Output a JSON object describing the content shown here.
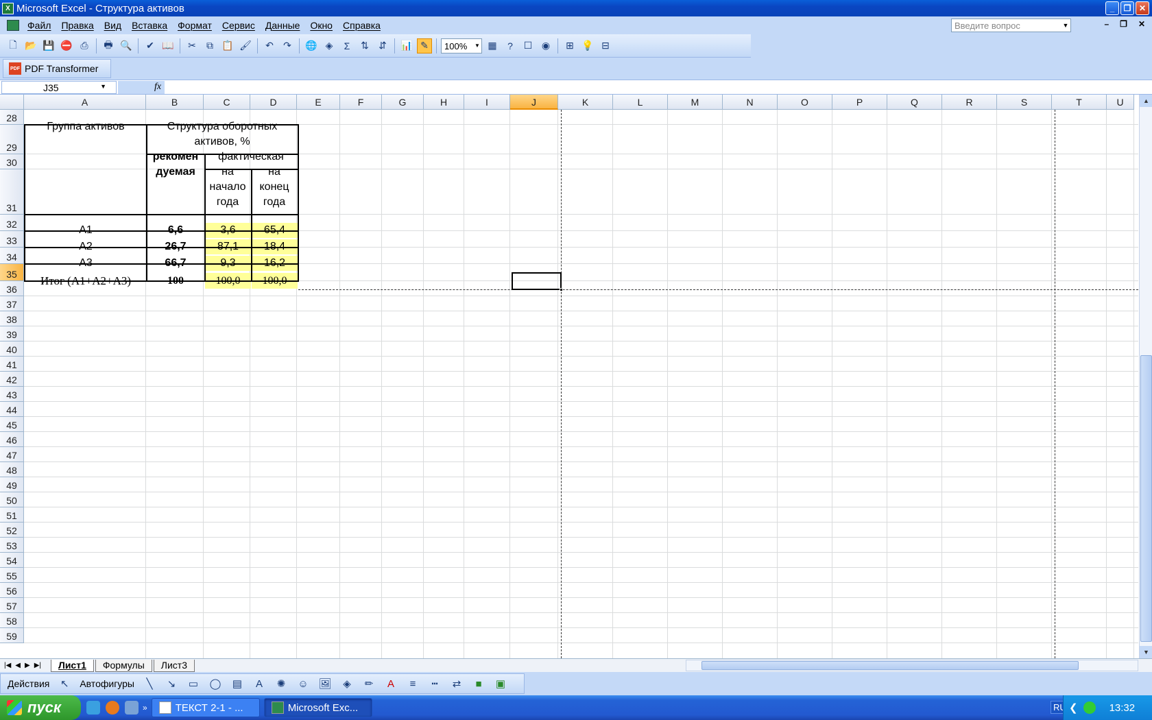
{
  "window": {
    "title": "Microsoft Excel - Структура активов"
  },
  "menu": [
    "Файл",
    "Правка",
    "Вид",
    "Вставка",
    "Формат",
    "Сервис",
    "Данные",
    "Окно",
    "Справка"
  ],
  "ask_placeholder": "Введите вопрос",
  "toolbar": {
    "zoom": "100%"
  },
  "pdf_toolbar": {
    "label": "PDF Transformer"
  },
  "formula_bar": {
    "name_box": "J35",
    "fx": "fx",
    "formula": ""
  },
  "columns": [
    "A",
    "B",
    "C",
    "D",
    "E",
    "F",
    "G",
    "H",
    "I",
    "J",
    "K",
    "L",
    "M",
    "N",
    "O",
    "P",
    "Q",
    "R",
    "S",
    "T",
    "U"
  ],
  "selected_column": "J",
  "rows": [
    "28",
    "29",
    "30",
    "31",
    "32",
    "33",
    "34",
    "35",
    "36",
    "37",
    "38",
    "39",
    "40",
    "41",
    "42",
    "43",
    "44",
    "45",
    "46",
    "47",
    "48",
    "49",
    "50",
    "51",
    "52",
    "53",
    "54",
    "55",
    "56",
    "57",
    "58",
    "59"
  ],
  "selected_row": "35",
  "table": {
    "h_group": "Группа активов",
    "h_structure_1": "Структура оборотных",
    "h_structure_2": "активов, %",
    "h_recommended_1": "рекомен",
    "h_recommended_2": "дуемая",
    "h_actual": "фактическая",
    "h_start_1": "на",
    "h_start_2": "начало",
    "h_start_3": "года",
    "h_end_1": "на",
    "h_end_2": "конец",
    "h_end_3": "года",
    "rows": [
      {
        "group": "А1",
        "recommended": "6,6",
        "start": "3,6",
        "end": "65,4"
      },
      {
        "group": "А2",
        "recommended": "26,7",
        "start": "87,1",
        "end": "18,4"
      },
      {
        "group": "А3",
        "recommended": "66,7",
        "start": "9,3",
        "end": "16,2"
      },
      {
        "group": "Итог (А1+А2+А3)",
        "recommended": "100",
        "start": "100,0",
        "end": "100,0"
      }
    ]
  },
  "sheets": [
    "Лист1",
    "Формулы",
    "Лист3"
  ],
  "active_sheet": "Лист1",
  "draw_toolbar": {
    "actions": "Действия",
    "autoshapes": "Автофигуры"
  },
  "taskbar": {
    "start": "пуск",
    "tasks": [
      "ТЕКСТ 2-1 - ...",
      "Microsoft Exc..."
    ],
    "lang": "RU",
    "clock": "13:32"
  }
}
